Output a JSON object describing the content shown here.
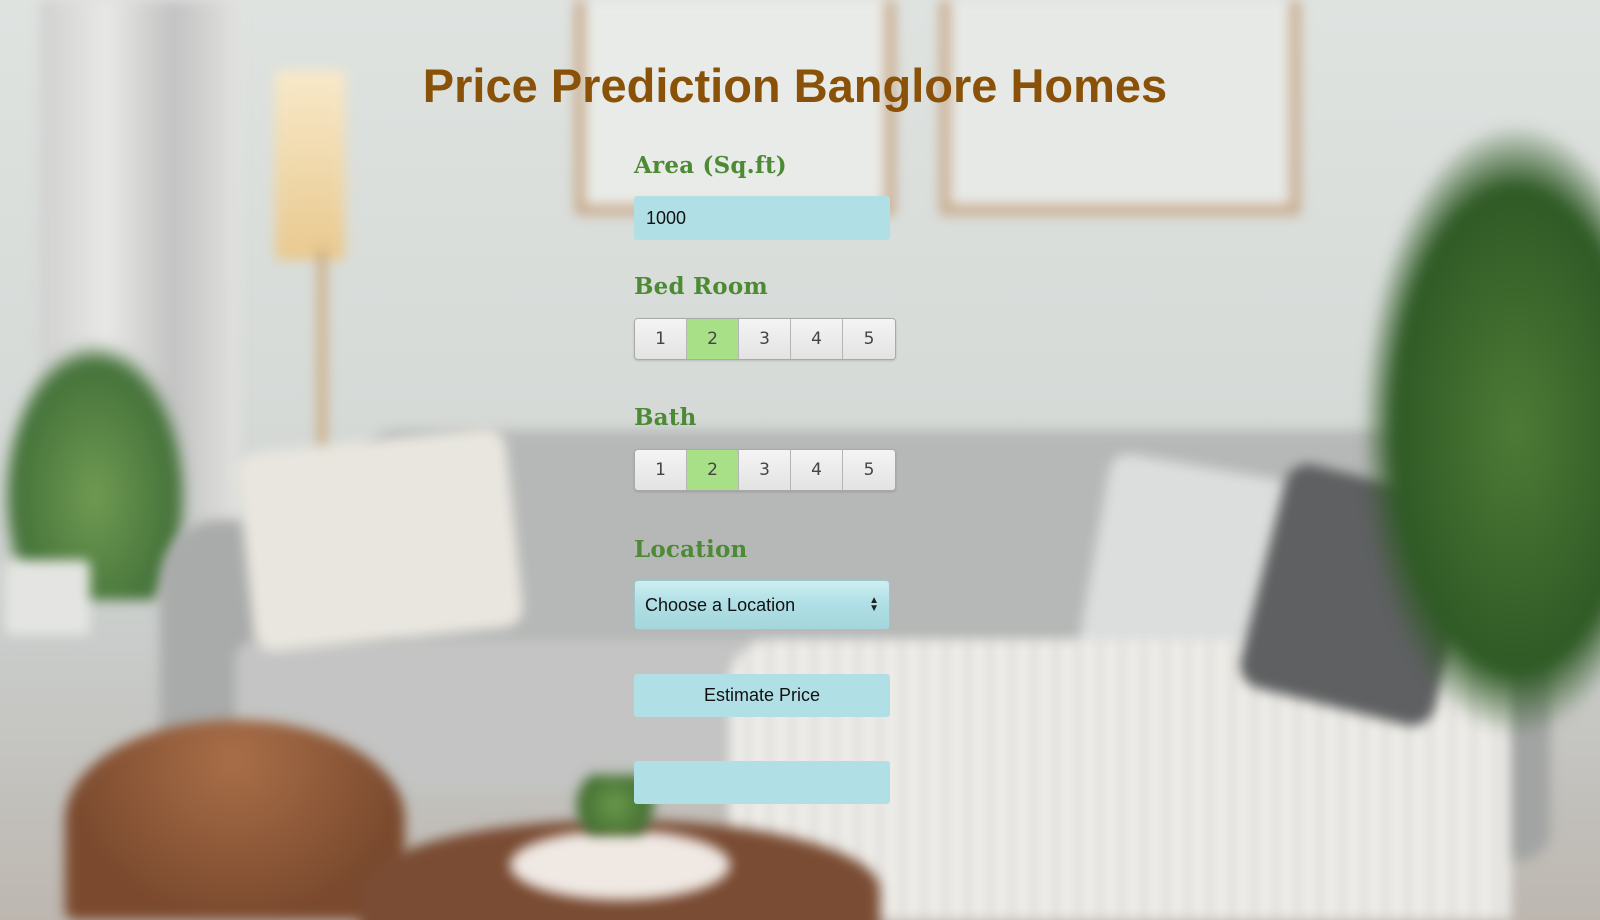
{
  "page": {
    "title": "Price Prediction Banglore Homes"
  },
  "form": {
    "area": {
      "label": "Area (Sq.ft)",
      "value": "1000"
    },
    "bedroom": {
      "label": "Bed Room",
      "options": [
        "1",
        "2",
        "3",
        "4",
        "5"
      ],
      "selected": "2"
    },
    "bath": {
      "label": "Bath",
      "options": [
        "1",
        "2",
        "3",
        "4",
        "5"
      ],
      "selected": "2"
    },
    "location": {
      "label": "Location",
      "selected": "Choose a Location"
    },
    "estimate_button": "Estimate Price",
    "result": ""
  },
  "colors": {
    "title": "#8a5208",
    "label": "#4d8a35",
    "field_bg": "#b0e0e6",
    "selected_segment": "#a7e087"
  }
}
